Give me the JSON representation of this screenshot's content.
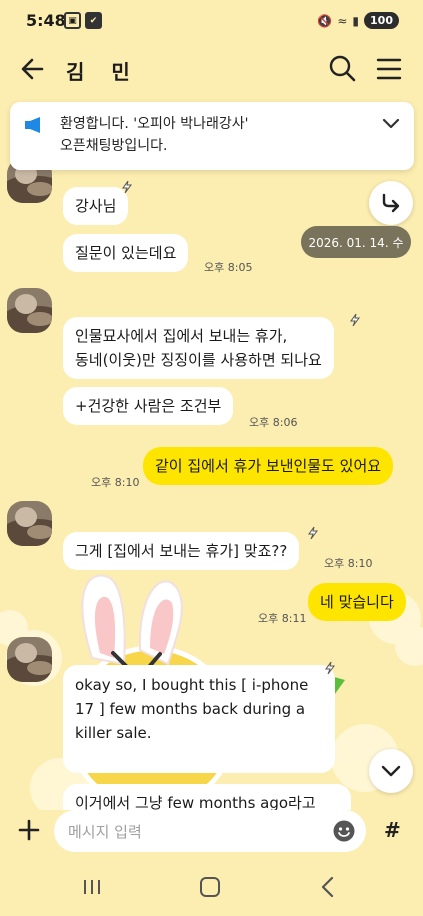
{
  "status": {
    "time": "5:48",
    "battery": "100"
  },
  "header": {
    "title": "김 민"
  },
  "notice": {
    "line1": "환영합니다. '오피아 박나래강사'",
    "line2": "오픈채팅방입니다."
  },
  "date_chip": "2026. 01. 14. 수",
  "messages": [
    {
      "text": "강사님"
    },
    {
      "text": "질문이 있는데요",
      "time": "오후 8:05"
    },
    {
      "line1": "인물묘사에서 집에서 보내는 휴가,",
      "line2": "동네(이웃)만 징징이를 사용하면 되나요"
    },
    {
      "text": "+건강한 사람은 조건부",
      "time": "오후 8:06"
    },
    {
      "text": "같이 집에서 휴가 보낸인물도 있어요",
      "time": "오후 8:10"
    },
    {
      "text": "그게 [집에서 보내는 휴가] 맞죠??",
      "time": "오후 8:10"
    },
    {
      "text": "네 맞습니다",
      "time": "오후 8:11"
    },
    {
      "text": "okay so, I bought this [ i-phone 17 ] few months back during a killer sale."
    },
    {
      "text": "이거에서 그냥 few months ago라고"
    }
  ],
  "input": {
    "placeholder": "메시지 입력"
  },
  "colors": {
    "background": "#fcedb0",
    "my_bubble": "#fee500",
    "other_bubble": "#ffffff",
    "date_chip": "#79735b"
  }
}
